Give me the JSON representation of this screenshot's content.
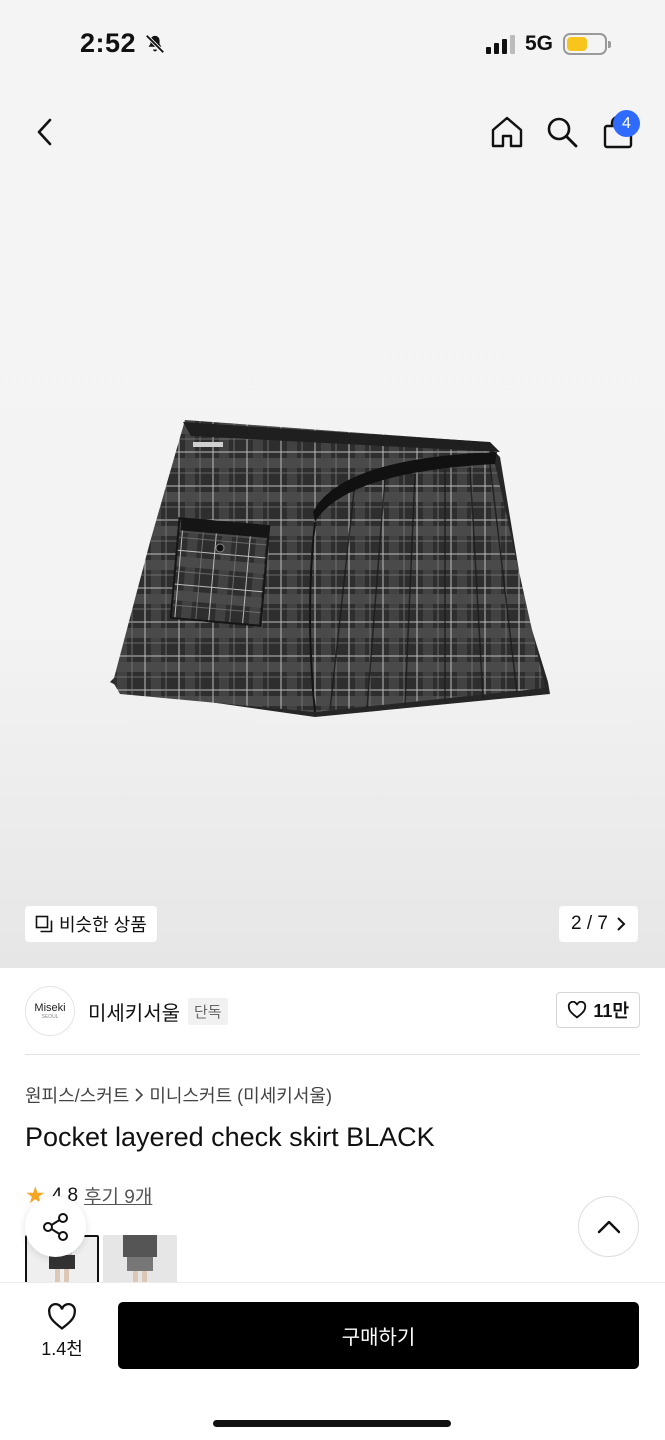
{
  "status": {
    "time": "2:52",
    "network": "5G",
    "battery_level": 0.55,
    "battery_color": "#f7c51c"
  },
  "nav": {
    "cart_count": "4",
    "badge_color": "#2f6bff"
  },
  "gallery": {
    "similar_label": "비슷한 상품",
    "page": "2 / 7"
  },
  "brand": {
    "logo_text": "Miseki",
    "logo_subtext": "SEOUL",
    "name": "미세키서울",
    "tag": "단독",
    "likes": "11만"
  },
  "breadcrumb": {
    "category": "원피스/스커트",
    "subcategory": "미니스커트 (미세키서울)"
  },
  "product": {
    "title": "Pocket layered check skirt BLACK",
    "rating": "4.8",
    "reviews": "후기 9개"
  },
  "bottom": {
    "wish_count": "1.4천",
    "buy_label": "구매하기"
  }
}
